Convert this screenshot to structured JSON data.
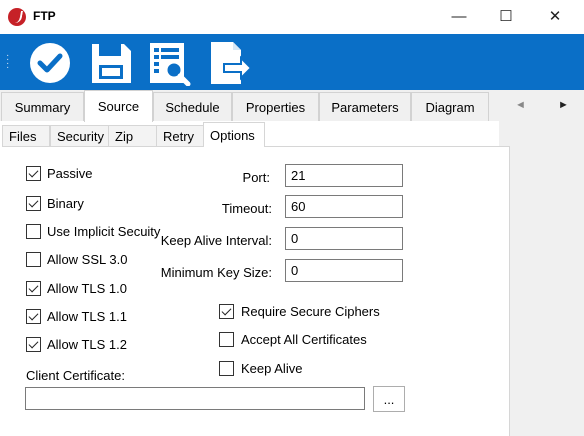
{
  "window": {
    "title": "FTP",
    "minimize": "—",
    "maximize": "☐",
    "close": "✕"
  },
  "toolbar": {
    "icons": [
      "save-check-icon",
      "floppy-disk-icon",
      "report-search-icon",
      "export-document-icon"
    ]
  },
  "tabs": [
    "Summary",
    "Source",
    "Schedule",
    "Properties",
    "Parameters",
    "Diagram"
  ],
  "active_tab": "Source",
  "tab_nav": {
    "prev": "◄",
    "next": "►"
  },
  "subtabs": [
    "Files",
    "Security",
    "Zip",
    "Retry",
    "Options"
  ],
  "active_subtab": "Options",
  "options": {
    "left_checks": [
      {
        "label": "Passive",
        "checked": true
      },
      {
        "label": "Binary",
        "checked": true
      },
      {
        "label": "Use Implicit Secuity",
        "checked": false
      },
      {
        "label": "Allow SSL 3.0",
        "checked": false
      },
      {
        "label": "Allow TLS 1.0",
        "checked": true
      },
      {
        "label": "Allow TLS 1.1",
        "checked": true
      },
      {
        "label": "Allow TLS 1.2",
        "checked": true
      }
    ],
    "fields": [
      {
        "label": "Port:",
        "value": "21"
      },
      {
        "label": "Timeout:",
        "value": "60"
      },
      {
        "label": "Keep Alive Interval:",
        "value": "0"
      },
      {
        "label": "Minimum Key Size:",
        "value": "0"
      }
    ],
    "right_checks": [
      {
        "label": "Require Secure Ciphers",
        "checked": true
      },
      {
        "label": "Accept All Certificates",
        "checked": false
      },
      {
        "label": "Keep Alive",
        "checked": false
      }
    ],
    "client_certificate": {
      "label": "Client Certificate:",
      "value": "",
      "browse_label": "..."
    }
  },
  "colors": {
    "toolbar": "#0a6fc7",
    "brand": "#c62127"
  }
}
